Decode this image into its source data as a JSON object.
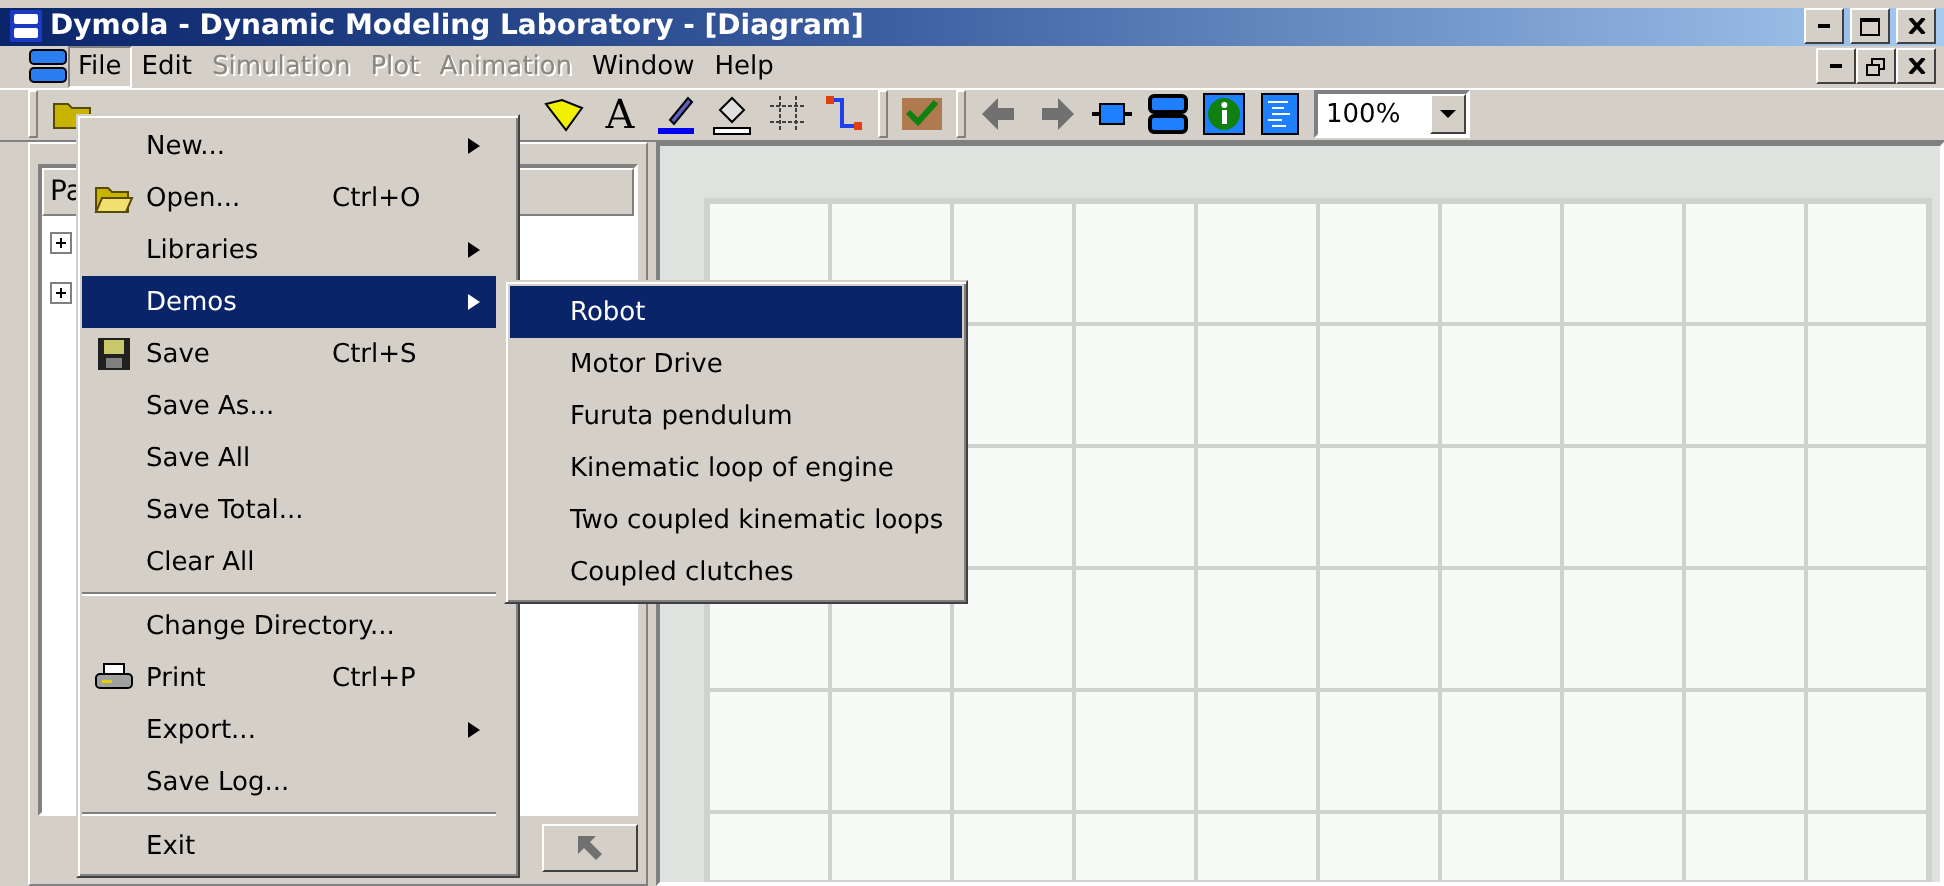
{
  "window": {
    "title": "Dymola - Dynamic Modeling Laboratory - [Diagram]"
  },
  "menu_bar": [
    {
      "label": "File",
      "selected": true,
      "disabled": false
    },
    {
      "label": "Edit",
      "selected": false,
      "disabled": false
    },
    {
      "label": "Simulation",
      "selected": false,
      "disabled": true
    },
    {
      "label": "Plot",
      "selected": false,
      "disabled": true
    },
    {
      "label": "Animation",
      "selected": false,
      "disabled": true
    },
    {
      "label": "Window",
      "selected": false,
      "disabled": false
    },
    {
      "label": "Help",
      "selected": false,
      "disabled": false
    }
  ],
  "toolbar": {
    "zoom": "100%",
    "text_tool": "A"
  },
  "left_pane": {
    "header": "Pa",
    "tree": [
      {
        "expanded": false
      },
      {
        "expanded": false
      }
    ]
  },
  "file_menu": [
    {
      "kind": "item",
      "label": "New...",
      "submenu": true,
      "selected": false
    },
    {
      "kind": "item",
      "label": "Open...",
      "shortcut": "Ctrl+O",
      "selected": false
    },
    {
      "kind": "item",
      "label": "Libraries",
      "submenu": true,
      "selected": false
    },
    {
      "kind": "item",
      "label": "Demos",
      "submenu": true,
      "selected": true
    },
    {
      "kind": "item",
      "label": "Save",
      "shortcut": "Ctrl+S",
      "selected": false
    },
    {
      "kind": "item",
      "label": "Save As...",
      "selected": false
    },
    {
      "kind": "item",
      "label": "Save All",
      "selected": false
    },
    {
      "kind": "item",
      "label": "Save Total...",
      "selected": false
    },
    {
      "kind": "item",
      "label": "Clear All",
      "selected": false
    },
    {
      "kind": "separator"
    },
    {
      "kind": "item",
      "label": "Change Directory...",
      "selected": false
    },
    {
      "kind": "item",
      "label": "Print",
      "shortcut": "Ctrl+P",
      "selected": false
    },
    {
      "kind": "item",
      "label": "Export...",
      "submenu": true,
      "selected": false
    },
    {
      "kind": "item",
      "label": "Save Log...",
      "selected": false
    },
    {
      "kind": "separator"
    },
    {
      "kind": "item",
      "label": "Exit",
      "selected": false
    }
  ],
  "demos_menu": [
    {
      "label": "Robot",
      "selected": true
    },
    {
      "label": "Motor Drive",
      "selected": false
    },
    {
      "label": "Furuta pendulum",
      "selected": false
    },
    {
      "label": "Kinematic loop of engine",
      "selected": false
    },
    {
      "label": "Two coupled kinematic loops",
      "selected": false
    },
    {
      "label": "Coupled clutches",
      "selected": false
    }
  ]
}
